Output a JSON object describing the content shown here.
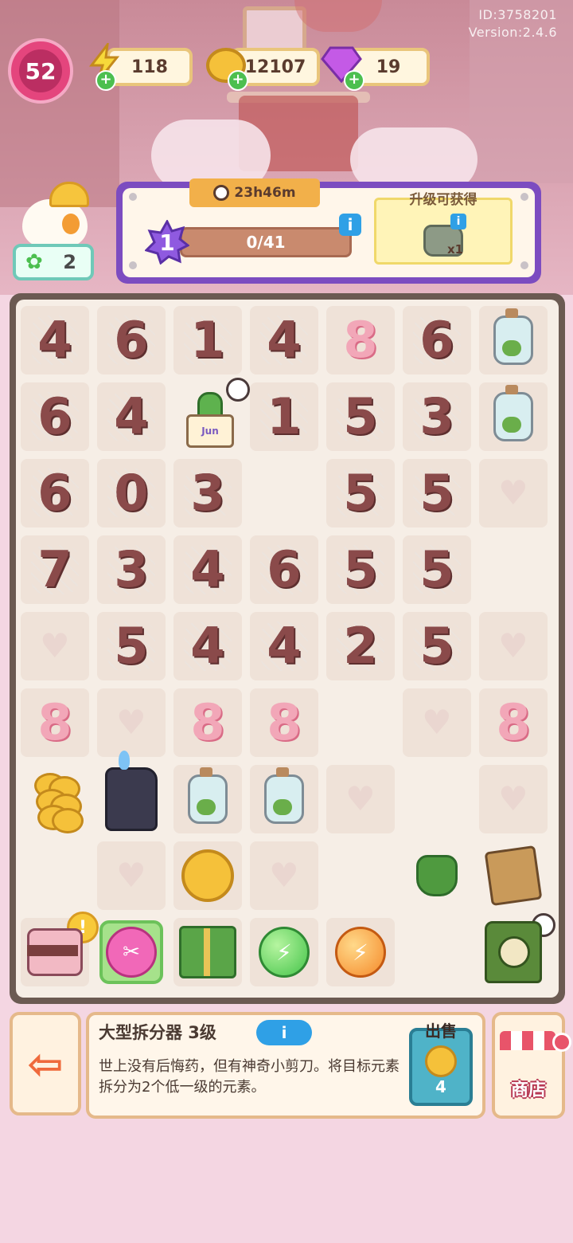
{
  "header": {
    "id_text": "ID:3758201",
    "version_text": "Version:2.4.6",
    "player_level": "52",
    "energy": "118",
    "coins": "12107",
    "gems": "19",
    "stars": "2"
  },
  "quest": {
    "timer": "23h46m",
    "level": "1",
    "progress": "0/41",
    "progress_fraction": 0,
    "reward_title": "升级可获得",
    "reward_count": "x1"
  },
  "board": {
    "rows": [
      [
        "web:4",
        "web:6",
        "web:1",
        "web:4",
        "pink:8",
        "web:6",
        "bottle-bulb"
      ],
      [
        "web:6",
        "web:4",
        "item:cactus-plant",
        "web:1",
        "web:5",
        "web:3",
        "bottle-bulb"
      ],
      [
        "web:6",
        "web:0",
        "web:3",
        "empty",
        "web:5",
        "web:5",
        "heart"
      ],
      [
        "web:7",
        "web:3",
        "web:4",
        "web:6",
        "web:5",
        "web:5",
        "empty"
      ],
      [
        "heart",
        "web:5",
        "web:4",
        "web:4",
        "web:2",
        "web:5",
        "heart"
      ],
      [
        "pink:8",
        "heart",
        "pink:8",
        "pink:8",
        "empty",
        "heart",
        "pink:8"
      ],
      [
        "item:coin-stack",
        "item:lighter",
        "item:slime-jar",
        "item:slime-jar-2",
        "heart",
        "empty",
        "heart"
      ],
      [
        "empty",
        "heart",
        "item:big-coin",
        "heart",
        "empty",
        "item:money-bag",
        "item:picture-frame"
      ],
      [
        "item:cake",
        "item:scissor",
        "item:gift",
        "item:green-orb",
        "item:orange-orb",
        "empty",
        "item:clock-box"
      ]
    ],
    "lighter_flame_color": "#7ec3f5"
  },
  "detail": {
    "item_name": "大型拆分器 3级",
    "description": "世上没有后悔药，但有神奇小剪刀。将目标元素拆分为2个低一级的元素。",
    "sell_label": "出售",
    "sell_price": "4",
    "shop_label": "商店"
  },
  "colors": {
    "accent_purple": "#7c4cc0",
    "level_pink": "#e4457d",
    "web_number": "#8a4a4a",
    "pink_number": "#f2a7b8"
  }
}
